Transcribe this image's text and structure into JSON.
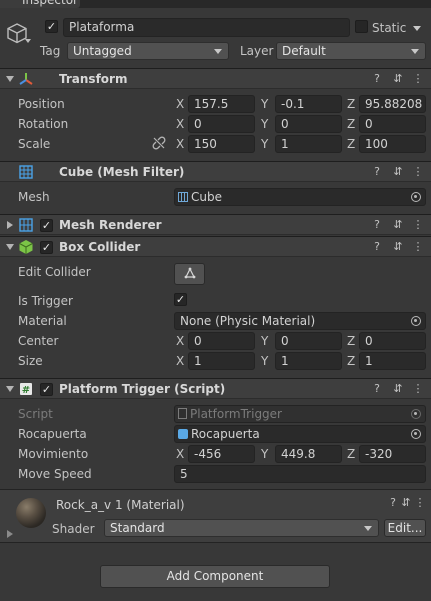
{
  "window": {
    "tab_title": "Inspector"
  },
  "object": {
    "name": "Plataforma",
    "static_label": "Static",
    "tag_label": "Tag",
    "tag_value": "Untagged",
    "layer_label": "Layer",
    "layer_value": "Default"
  },
  "transform": {
    "title": "Transform",
    "rows": [
      {
        "label": "Position",
        "x": "157.5",
        "y": "-0.1",
        "z": "95.88208"
      },
      {
        "label": "Rotation",
        "x": "0",
        "y": "0",
        "z": "0"
      },
      {
        "label": "Scale",
        "x": "150",
        "y": "1",
        "z": "100"
      }
    ],
    "axis_x": "X",
    "axis_y": "Y",
    "axis_z": "Z"
  },
  "mesh_filter": {
    "title": "Cube (Mesh Filter)",
    "mesh_label": "Mesh",
    "mesh_value": "Cube"
  },
  "mesh_renderer": {
    "title": "Mesh Renderer"
  },
  "box_collider": {
    "title": "Box Collider",
    "edit_collider_label": "Edit Collider",
    "is_trigger_label": "Is Trigger",
    "material_label": "Material",
    "material_value": "None (Physic Material)",
    "center_label": "Center",
    "center": {
      "x": "0",
      "y": "0",
      "z": "0"
    },
    "size_label": "Size",
    "size": {
      "x": "1",
      "y": "1",
      "z": "1"
    }
  },
  "platform_trigger": {
    "title": "Platform Trigger (Script)",
    "script_label": "Script",
    "script_value": "PlatformTrigger",
    "rocapuerta_label": "Rocapuerta",
    "rocapuerta_value": "Rocapuerta",
    "movimiento_label": "Movimiento",
    "movimiento": {
      "x": "-456",
      "y": "449.8",
      "z": "-320"
    },
    "move_speed_label": "Move Speed",
    "move_speed_value": "5"
  },
  "material": {
    "title": "Rock_a_v 1 (Material)",
    "shader_label": "Shader",
    "shader_value": "Standard",
    "edit_label": "Edit..."
  },
  "footer": {
    "add_component_label": "Add Component"
  },
  "icons": {
    "checkmark": "✓",
    "help": "?",
    "settings": "⇵",
    "more": "⋮",
    "constrain": "∞"
  }
}
